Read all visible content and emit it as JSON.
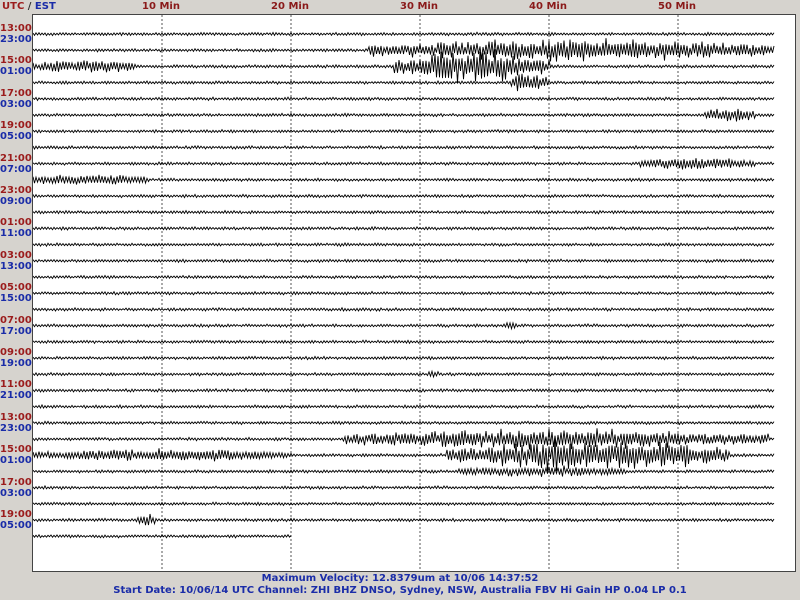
{
  "header": {
    "utc_label": "UTC",
    "separator": "/",
    "est_label": "EST"
  },
  "footer": {
    "line1": "Maximum Velocity: 12.8379um at 10/06 14:37:52",
    "line2": "Start Date: 10/06/14 UTC Channel: ZHI  BHZ  DNSO, Sydney, NSW, Australia  FBV Hi Gain HP 0.04 LP 0.1"
  },
  "colors": {
    "utc": "#9b1c1c",
    "est": "#1a2ca8",
    "trace": "#000000",
    "gridline": "#555555",
    "background": "#d6d3ce"
  },
  "chart_data": {
    "type": "line",
    "x_ticks": [
      {
        "min": 10,
        "label": "10 Min"
      },
      {
        "min": 20,
        "label": "20 Min"
      },
      {
        "min": 30,
        "label": "30 Min"
      },
      {
        "min": 40,
        "label": "40 Min"
      },
      {
        "min": 50,
        "label": "50 Min"
      }
    ],
    "xlim": [
      0,
      57.5
    ],
    "grid": "dashed-vertical",
    "row_labels": [
      {
        "utc": "13:00",
        "est": "23:00"
      },
      {
        "utc": "15:00",
        "est": "01:00"
      },
      {
        "utc": "17:00",
        "est": "03:00"
      },
      {
        "utc": "19:00",
        "est": "05:00"
      },
      {
        "utc": "21:00",
        "est": "07:00"
      },
      {
        "utc": "23:00",
        "est": "09:00"
      },
      {
        "utc": "01:00",
        "est": "11:00"
      },
      {
        "utc": "03:00",
        "est": "13:00"
      },
      {
        "utc": "05:00",
        "est": "15:00"
      },
      {
        "utc": "07:00",
        "est": "17:00"
      },
      {
        "utc": "09:00",
        "est": "19:00"
      },
      {
        "utc": "11:00",
        "est": "21:00"
      },
      {
        "utc": "13:00",
        "est": "23:00"
      },
      {
        "utc": "15:00",
        "est": "01:00"
      },
      {
        "utc": "17:00",
        "est": "03:00"
      },
      {
        "utc": "19:00",
        "est": "05:00"
      }
    ],
    "traces_per_label": 2,
    "last_trace_end_min": 20,
    "events": [
      {
        "trace": 1,
        "start": 26,
        "end": 58,
        "amp": 1.0
      },
      {
        "trace": 2,
        "start": 0,
        "end": 8,
        "amp": 0.55
      },
      {
        "trace": 2,
        "start": 28,
        "end": 40,
        "amp": 1.6
      },
      {
        "trace": 3,
        "start": 37,
        "end": 40,
        "amp": 1.0
      },
      {
        "trace": 5,
        "start": 52,
        "end": 56,
        "amp": 0.6
      },
      {
        "trace": 8,
        "start": 47,
        "end": 56,
        "amp": 0.5
      },
      {
        "trace": 9,
        "start": 0,
        "end": 9,
        "amp": 0.45
      },
      {
        "trace": 18,
        "start": 36.5,
        "end": 37.5,
        "amp": 0.35
      },
      {
        "trace": 21,
        "start": 30.5,
        "end": 31.5,
        "amp": 0.3
      },
      {
        "trace": 25,
        "start": 24,
        "end": 57,
        "amp": 0.9
      },
      {
        "trace": 26,
        "start": 0,
        "end": 20,
        "amp": 0.5
      },
      {
        "trace": 26,
        "start": 32,
        "end": 54,
        "amp": 1.5
      },
      {
        "trace": 27,
        "start": 33,
        "end": 46,
        "amp": 0.4
      },
      {
        "trace": 30,
        "start": 8,
        "end": 9.5,
        "amp": 0.5
      }
    ]
  }
}
